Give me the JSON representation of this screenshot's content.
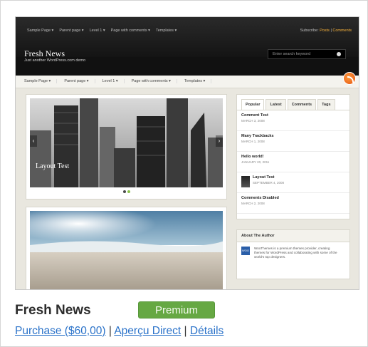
{
  "theme": {
    "name": "Fresh News",
    "badge": "Premium",
    "links": {
      "purchase": "Purchase ($60,00)",
      "preview": "Aperçu Direct",
      "details": "Détails",
      "separator": "|"
    }
  },
  "preview": {
    "top_nav": [
      "Sample Page ▾",
      "Parent page ▾",
      "Level 1 ▾",
      "Page with comments ▾",
      "Templates ▾"
    ],
    "subscribe": {
      "label": "Subscribe:",
      "posts": "Posts",
      "sep": "|",
      "comments": "Comments"
    },
    "site_title": "Fresh News",
    "site_tagline": "Just another WordPress.com demo",
    "search_placeholder": "Enter search keyword",
    "sub_nav": [
      "Sample Page ▾",
      "Parent page ▾",
      "Level 1 ▾",
      "Page with comments ▾",
      "Templates ▾"
    ],
    "slide_caption": "Layout Test",
    "sidebar_tabs": [
      "Popular",
      "Latest",
      "Comments",
      "Tags"
    ],
    "sidebar_entries": [
      {
        "title": "Comment Test",
        "date": "MARCH 3, 2008"
      },
      {
        "title": "Many Trackbacks",
        "date": "MARCH 1, 2008"
      },
      {
        "title": "Hello world!",
        "date": "JANUARY 20, 2011"
      },
      {
        "title": "Layout Test",
        "date": "SEPTEMBER 4, 2008"
      },
      {
        "title": "Comments Disabled",
        "date": "MARCH 2, 2008"
      }
    ],
    "author_heading": "About The Author",
    "author_logo": "WOO",
    "author_text": "WooThemes is a premium themes provider, creating themes for WordPress and collaborating with some of the world's top designers."
  },
  "colors": {
    "badge_green": "#66a843",
    "link_blue": "#2a72c9",
    "rss_orange": "#e2520e"
  },
  "icons": [
    "rss-icon",
    "search-icon",
    "arrow-left-icon",
    "arrow-right-icon"
  ]
}
